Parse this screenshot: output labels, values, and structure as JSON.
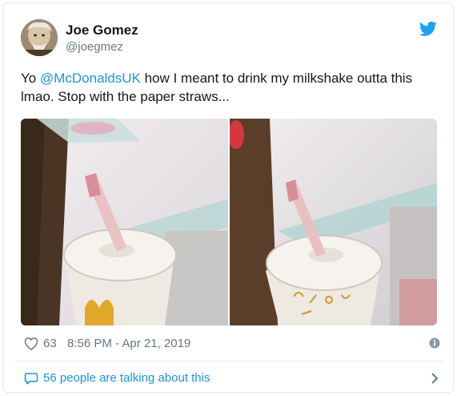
{
  "author": {
    "display_name": "Joe Gomez",
    "handle": "@joegmez"
  },
  "tweet": {
    "prefix": "Yo ",
    "mention": "@McDonaldsUK",
    "body": " how I meant to drink my milkshake outta this lmao. Stop with the paper straws..."
  },
  "media": {
    "photos": [
      "photo-cup-left",
      "photo-cup-right"
    ]
  },
  "meta": {
    "likes": "63",
    "timestamp": "8:56 PM - Apr 21, 2019"
  },
  "footer": {
    "talking": "56 people are talking about this"
  },
  "colors": {
    "link": "#1b95e0",
    "secondary": "#657786",
    "twitter_blue": "#1da1f2"
  }
}
